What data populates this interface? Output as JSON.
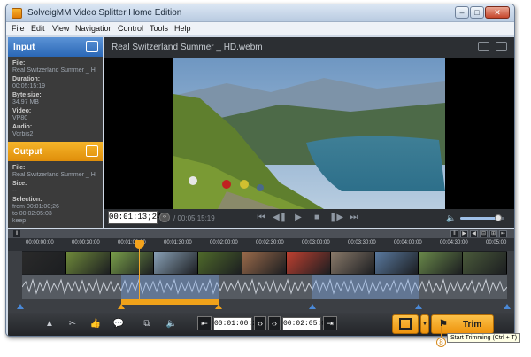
{
  "window": {
    "title": "SolveigMM Video Splitter Home Edition",
    "min": "–",
    "max": "□",
    "close": "✕"
  },
  "menu": [
    "File",
    "Edit",
    "View",
    "Navigation",
    "Control",
    "Tools",
    "Help"
  ],
  "input": {
    "header": "Input",
    "file_label": "File:",
    "file_value": "Real Switzerland Summer _ H",
    "duration_label": "Duration:",
    "duration_value": "00:05:15:19",
    "bytes_label": "Byte size:",
    "bytes_value": "34.97 MB",
    "video_label": "Video:",
    "video_value": "VP80",
    "audio_label": "Audio:",
    "audio_value": "Vorbis2"
  },
  "output": {
    "header": "Output",
    "file_label": "File:",
    "file_value": "Real Switzerland Summer _ H",
    "size_label": "Size:",
    "size_value": "--",
    "selection_label": "Selection:",
    "from_value": "from  00:01:00;26",
    "to_value": "to      00:02:05:03",
    "keep_value": "keep"
  },
  "player": {
    "filename": "Real Switzerland Summer _ HD.webm",
    "current_time": "00:01:13;24",
    "duration": "/ 00:05:15:19",
    "controls": [
      "⏮",
      "◀❚",
      "▶",
      "■",
      "❚▶",
      "⏭"
    ],
    "volume_level": 0.88
  },
  "timeline": {
    "ticks": [
      "00;00;00;00",
      "00;00;30;00",
      "00;01;00;00",
      "00;01;30;00",
      "00;02;00;00",
      "00;02;30;00",
      "00;03;00;00",
      "00;03;30;00",
      "00;04;00;00",
      "00;04;30;00",
      "00;05;00"
    ],
    "zoom_buttons": [
      "‖",
      "▶",
      "◀",
      "⊟",
      "⊞",
      "⇤"
    ],
    "thumb_colors": [
      "#2a2a2a",
      "#6f8a3a",
      "#7aa04a",
      "#8aa2b8",
      "#4f6a2a",
      "#9a6a4a",
      "#c04030",
      "#8a7a6a",
      "#5a7aa0",
      "#6a8a4a",
      "#4a5a3a"
    ]
  },
  "toolbar": {
    "tools": [
      "▲",
      "✂",
      "👍",
      "💬",
      "⧉",
      "🔈"
    ],
    "start_time": "00:01:00:26",
    "end_time": "00:02:05:03",
    "trim_label": "Trim",
    "tooltip": "Start Trimming (Ctrl + T)",
    "callout_number": "8"
  }
}
